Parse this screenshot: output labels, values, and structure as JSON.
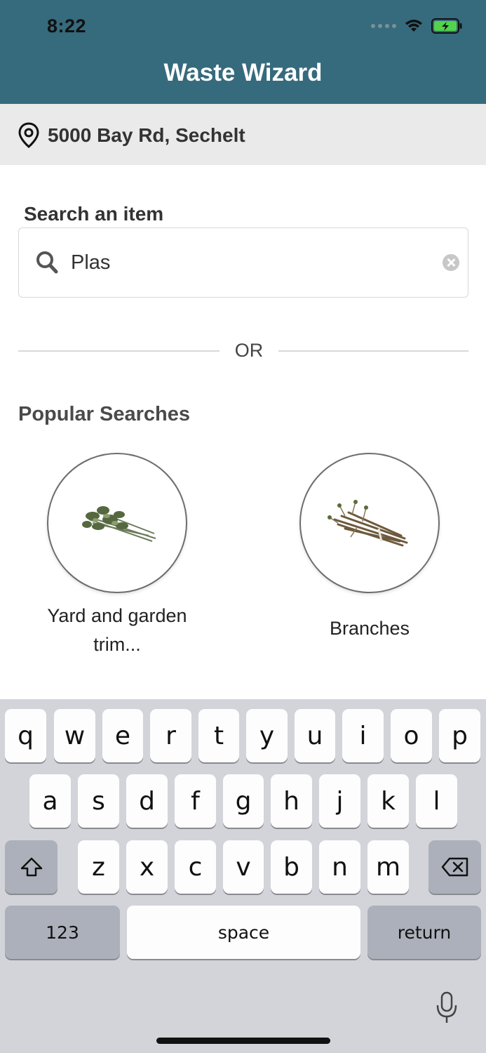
{
  "status_bar": {
    "time": "8:22"
  },
  "header": {
    "title": "Waste Wizard"
  },
  "location": {
    "address": "5000 Bay Rd, Sechelt"
  },
  "search": {
    "label": "Search an item",
    "value": "Plas"
  },
  "divider": {
    "text": "OR"
  },
  "popular": {
    "title": "Popular Searches",
    "items": [
      {
        "label": "Yard and garden trim..."
      },
      {
        "label": "Branches"
      }
    ]
  },
  "keyboard": {
    "row1": [
      "q",
      "w",
      "e",
      "r",
      "t",
      "y",
      "u",
      "i",
      "o",
      "p"
    ],
    "row2": [
      "a",
      "s",
      "d",
      "f",
      "g",
      "h",
      "j",
      "k",
      "l"
    ],
    "row3": [
      "z",
      "x",
      "c",
      "v",
      "b",
      "n",
      "m"
    ],
    "numbers_key": "123",
    "space_key": "space",
    "return_key": "return"
  },
  "colors": {
    "header_bg": "#366a7d",
    "location_bg": "#eaeaea",
    "keyboard_bg": "#d2d4d9"
  }
}
